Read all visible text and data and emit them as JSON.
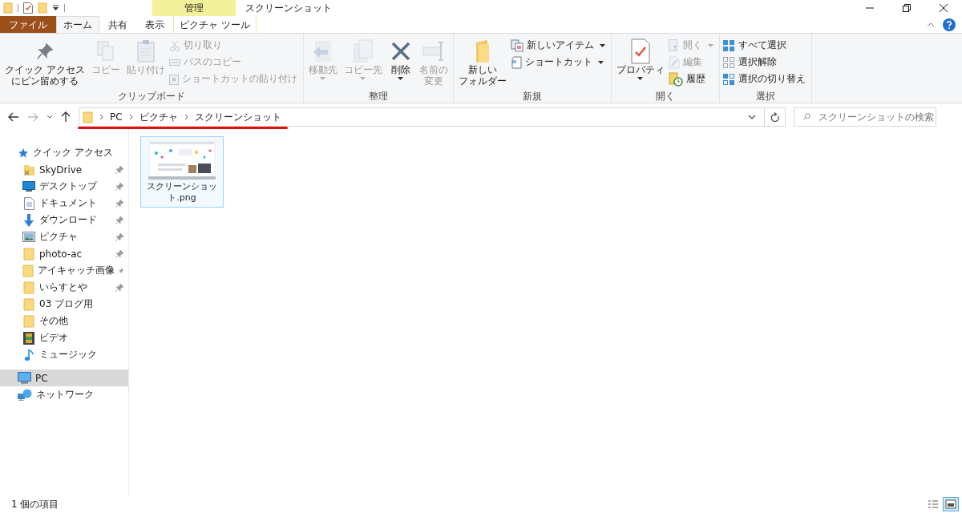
{
  "title_bar": {
    "context_label": "管理",
    "title": "スクリーンショット"
  },
  "tabs": [
    {
      "label": "ファイル",
      "kind": "file",
      "selected": false
    },
    {
      "label": "ホーム",
      "kind": "normal",
      "selected": true
    },
    {
      "label": "共有",
      "kind": "normal",
      "selected": false
    },
    {
      "label": "表示",
      "kind": "normal",
      "selected": false
    },
    {
      "label": "ピクチャ ツール",
      "kind": "context",
      "selected": false
    }
  ],
  "ribbon": {
    "groups": [
      {
        "label": "クリップボード",
        "buttons": [
          {
            "kind": "large",
            "lines": [
              "クイック アクセス",
              "にピン留めする"
            ],
            "disabled": false,
            "dropdown": false
          },
          {
            "kind": "large",
            "lines": [
              "コピー"
            ],
            "disabled": true,
            "dropdown": false
          },
          {
            "kind": "large",
            "lines": [
              "貼り付け"
            ],
            "disabled": true,
            "dropdown": false
          },
          {
            "kind": "small",
            "lines": [
              "切り取り"
            ],
            "disabled": true,
            "dropdown": false
          },
          {
            "kind": "small",
            "lines": [
              "パスのコピー"
            ],
            "disabled": true,
            "dropdown": false
          },
          {
            "kind": "small",
            "lines": [
              "ショートカットの貼り付け"
            ],
            "disabled": true,
            "dropdown": false
          }
        ]
      },
      {
        "label": "整理",
        "buttons": [
          {
            "kind": "large",
            "lines": [
              "移動先"
            ],
            "disabled": true,
            "dropdown": true
          },
          {
            "kind": "large",
            "lines": [
              "コピー先"
            ],
            "disabled": true,
            "dropdown": true
          },
          {
            "kind": "large",
            "lines": [
              "削除"
            ],
            "disabled": false,
            "dropdown": true
          },
          {
            "kind": "large",
            "lines": [
              "名前の",
              "変更"
            ],
            "disabled": true,
            "dropdown": false
          }
        ]
      },
      {
        "label": "新規",
        "buttons": [
          {
            "kind": "large",
            "lines": [
              "新しい",
              "フォルダー"
            ],
            "disabled": false,
            "dropdown": false
          },
          {
            "kind": "small",
            "lines": [
              "新しいアイテム"
            ],
            "disabled": false,
            "dropdown": true
          },
          {
            "kind": "small",
            "lines": [
              "ショートカット"
            ],
            "disabled": false,
            "dropdown": true
          }
        ]
      },
      {
        "label": "開く",
        "buttons": [
          {
            "kind": "large",
            "lines": [
              "プロパティ"
            ],
            "disabled": false,
            "dropdown": true
          },
          {
            "kind": "small",
            "lines": [
              "開く"
            ],
            "disabled": true,
            "dropdown": true
          },
          {
            "kind": "small",
            "lines": [
              "編集"
            ],
            "disabled": true,
            "dropdown": false
          },
          {
            "kind": "small",
            "lines": [
              "履歴"
            ],
            "disabled": false,
            "dropdown": false
          }
        ]
      },
      {
        "label": "選択",
        "buttons": [
          {
            "kind": "small",
            "lines": [
              "すべて選択"
            ],
            "disabled": false,
            "dropdown": false
          },
          {
            "kind": "small",
            "lines": [
              "選択解除"
            ],
            "disabled": false,
            "dropdown": false
          },
          {
            "kind": "small",
            "lines": [
              "選択の切り替え"
            ],
            "disabled": false,
            "dropdown": false
          }
        ]
      }
    ]
  },
  "address": {
    "breadcrumb": [
      "PC",
      "ピクチャ",
      "スクリーンショット"
    ],
    "search_placeholder": "スクリーンショットの検索"
  },
  "navigation": [
    {
      "label": "クイック アクセス",
      "selected": false,
      "children": [
        {
          "label": "SkyDrive",
          "pinned": true,
          "selected": false
        },
        {
          "label": "デスクトップ",
          "pinned": true,
          "selected": false
        },
        {
          "label": "ドキュメント",
          "pinned": true,
          "selected": false
        },
        {
          "label": "ダウンロード",
          "pinned": true,
          "selected": false
        },
        {
          "label": "ピクチャ",
          "pinned": true,
          "selected": false
        },
        {
          "label": "photo-ac",
          "pinned": true,
          "selected": false
        },
        {
          "label": "アイキャッチ画像",
          "pinned": true,
          "selected": false
        },
        {
          "label": "いらすとや",
          "pinned": true,
          "selected": false
        },
        {
          "label": "03 ブログ用",
          "pinned": false,
          "selected": false
        },
        {
          "label": "その他",
          "pinned": false,
          "selected": false
        },
        {
          "label": "ビデオ",
          "pinned": false,
          "selected": false
        },
        {
          "label": "ミュージック",
          "pinned": false,
          "selected": false
        }
      ]
    },
    {
      "label": "PC",
      "selected": true
    },
    {
      "label": "ネットワーク",
      "selected": false
    }
  ],
  "files": [
    {
      "name": "スクリーンショット.png",
      "kind": "picture",
      "selected": true
    }
  ],
  "status_bar": {
    "item_count": "1 個の項目",
    "views": [
      {
        "selected": false
      },
      {
        "selected": true
      }
    ]
  }
}
